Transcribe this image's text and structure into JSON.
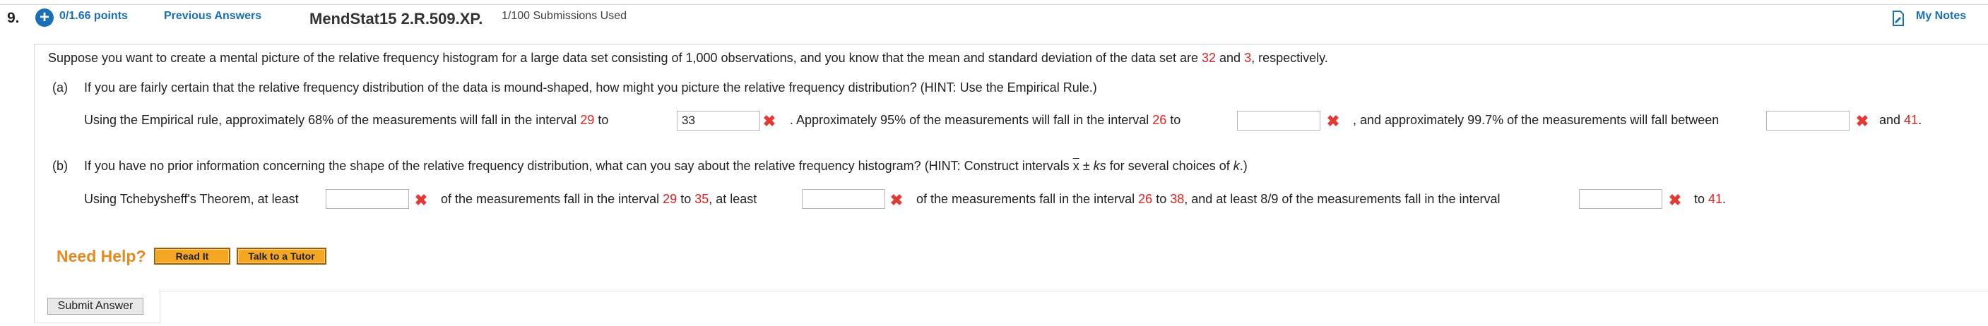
{
  "header": {
    "question_number": "9.",
    "points": "0/1.66 points",
    "previous_answers": "Previous Answers",
    "question_code": "MendStat15 2.R.509.XP.",
    "submissions": "1/100 Submissions Used",
    "my_notes": "My Notes"
  },
  "intro": {
    "text_1": "Suppose you want to create a mental picture of the relative frequency histogram for a large data set consisting of 1,000 observations, and you know that the mean and standard deviation of the data set are ",
    "mean": "32",
    "text_2": " and ",
    "sd": "3",
    "text_3": ", respectively."
  },
  "part_a": {
    "label": "(a)",
    "question": "If you are fairly certain that the relative frequency distribution of the data is mound-shaped, how might you picture the relative frequency distribution? (HINT: Use the Empirical Rule.)",
    "s1": "Using the Empirical rule, approximately 68% of the measurements will fall in the interval ",
    "v1": "29",
    "s2": " to ",
    "input1_value": "33",
    "s3": ". Approximately 95% of the measurements will fall in the interval ",
    "v2": "26",
    "s4": " to",
    "input2_value": "",
    "s5": ", and approximately 99.7% of the measurements will fall between",
    "input3_value": "",
    "s6": " and ",
    "v3": "41",
    "s7": "."
  },
  "part_b": {
    "label": "(b)",
    "question_1": "If you have no prior information concerning the shape of the relative frequency distribution, what can you say about the relative frequency histogram? (HINT: Construct intervals ",
    "xbar": "x",
    "question_2": " ± ",
    "ks": "ks",
    "question_3": " for several choices of ",
    "k": "k",
    "question_4": ".)",
    "s1": "Using Tchebysheff's Theorem, at least",
    "input1_value": "",
    "s2": "of the measurements fall in the interval ",
    "v1": "29",
    "s3": " to ",
    "v2": "35",
    "s4": ", at least",
    "input2_value": "",
    "s5": "of the measurements fall in the interval ",
    "v3": "26",
    "s6": " to ",
    "v4": "38",
    "s7": ", and at least 8/9 of the measurements fall in the interval",
    "input3_value": "",
    "s8": "to ",
    "v5": "41",
    "s9": "."
  },
  "help": {
    "label": "Need Help?",
    "read_it": "Read It",
    "talk_to_tutor": "Talk to a Tutor"
  },
  "submit": "Submit Answer",
  "colors": {
    "link_blue": "#1a6fb7",
    "value_red": "#e02020",
    "help_orange": "#e58a1e",
    "button_orange": "#f5a623",
    "x_mark_red": "#e53935"
  }
}
